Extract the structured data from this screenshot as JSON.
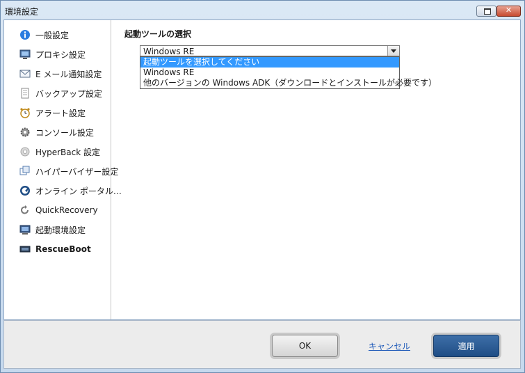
{
  "window": {
    "title": "環境設定",
    "restore_glyph": "",
    "close_glyph": "✕"
  },
  "sidebar": {
    "items": [
      {
        "label": "一般設定",
        "icon": "info-icon",
        "active": false
      },
      {
        "label": "プロキシ設定",
        "icon": "monitor-icon",
        "active": false
      },
      {
        "label": "E メール通知設定",
        "icon": "email-icon",
        "active": false
      },
      {
        "label": "バックアップ設定",
        "icon": "document-icon",
        "active": false
      },
      {
        "label": "アラート設定",
        "icon": "alarm-clock-icon",
        "active": false
      },
      {
        "label": "コンソール設定",
        "icon": "gear-icon",
        "active": false
      },
      {
        "label": "HyperBack 設定",
        "icon": "hyperback-icon",
        "active": false
      },
      {
        "label": "ハイパーバイザー設定",
        "icon": "hypervisor-icon",
        "active": false
      },
      {
        "label": "オンライン ポータル…",
        "icon": "online-portal-icon",
        "active": false
      },
      {
        "label": "QuickRecovery",
        "icon": "quickrecovery-icon",
        "active": false
      },
      {
        "label": "起動環境設定",
        "icon": "boot-environment-icon",
        "active": false
      },
      {
        "label": "RescueBoot",
        "icon": "rescueboot-icon",
        "active": true
      }
    ]
  },
  "main": {
    "section_title": "起動ツールの選択",
    "combo": {
      "selected_value": "Windows RE",
      "options": [
        {
          "label": "起動ツールを選択してください",
          "highlighted": true
        },
        {
          "label": "Windows RE",
          "highlighted": false
        },
        {
          "label": "他のバージョンの Windows ADK（ダウンロードとインストールが必要です）",
          "highlighted": false
        }
      ]
    }
  },
  "footer": {
    "ok_label": "OK",
    "cancel_label": "キャンセル",
    "apply_label": "適用"
  },
  "colors": {
    "highlight": "#3399ff",
    "apply_button": "#2a5a95",
    "link": "#1c58b8"
  }
}
